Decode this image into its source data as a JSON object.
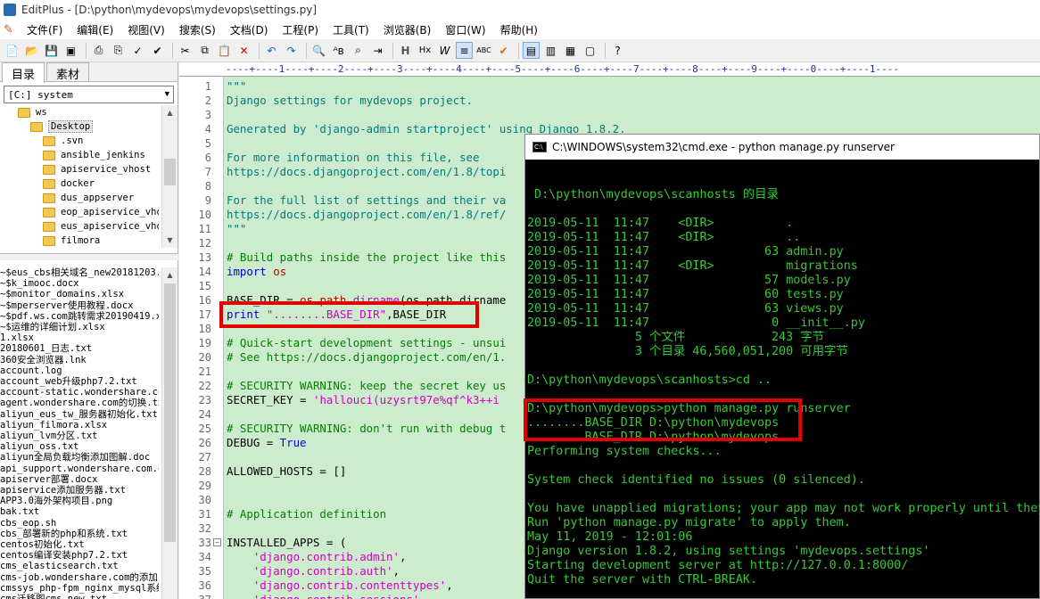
{
  "window": {
    "title": "EditPlus - [D:\\python\\mydevops\\mydevops\\settings.py]"
  },
  "menu": [
    "文件(F)",
    "编辑(E)",
    "视图(V)",
    "搜索(S)",
    "文档(D)",
    "工程(P)",
    "工具(T)",
    "浏览器(B)",
    "窗口(W)",
    "帮助(H)"
  ],
  "toolbar": {
    "buttons": [
      "new-file",
      "open-file",
      "save",
      "save-all",
      "print",
      "print-preview",
      "spell-check",
      "cut",
      "copy",
      "paste",
      "delete",
      "undo",
      "redo",
      "find",
      "replace",
      "find-in-files",
      "goto-line",
      "hex",
      "word-wrap",
      "ruler",
      "abc",
      "check",
      "view1",
      "view2",
      "view3",
      "view4",
      "help"
    ]
  },
  "left_panel": {
    "tabs": [
      "目录",
      "素材"
    ],
    "drive": "[C:] system",
    "tree": [
      {
        "label": "ws",
        "indent": 1
      },
      {
        "label": "Desktop",
        "indent": 2,
        "selected": true
      },
      {
        "label": ".svn",
        "indent": 3
      },
      {
        "label": "ansible_jenkins",
        "indent": 3
      },
      {
        "label": "apiservice_vhost",
        "indent": 3
      },
      {
        "label": "docker",
        "indent": 3
      },
      {
        "label": "dus_appserver",
        "indent": 3
      },
      {
        "label": "eop_apiservice_vhost.",
        "indent": 3
      },
      {
        "label": "eus_apiservice_vhost.",
        "indent": 3
      },
      {
        "label": "filmora",
        "indent": 3
      }
    ],
    "files": [
      "~$eus_cbs相关域名_new20181203.",
      "~$k_imooc.docx",
      "~$monitor_domains.xlsx",
      "~$mperserver使用教程.docx",
      "~$pdf.ws.com跳转需求20190419.x",
      "~$运维的详细计划.xlsx",
      "1.xlsx",
      "20180601_日志.txt",
      "360安全浏览器.lnk",
      "account.log",
      "account_web升级php7.2.txt",
      "account-static.wondershare.com",
      "agent.wondershare.com的切换.tx",
      "aliyun_eus_tw_服务器初始化.txt",
      "aliyun_filmora.xlsx",
      "aliyun_lvm分区.txt",
      "aliyun_oss.txt",
      "aliyun全局负载均衡添加图解.doc",
      "api_support.wondershare.com.ol",
      "apiserver部署.docx",
      "apiservice添加服务器.txt",
      "APP3.0海外架构项目.png",
      "bak.txt",
      "cbs_eop.sh",
      "cbs_部署新的php和系统.txt",
      "centos初始化.txt",
      "centos编译安装php7.2.txt",
      "cms_elasticsearch.txt",
      "cms-job.wondershare.com的添加",
      "cmssys_php-fpm_nginx_mysql系统",
      "cms迁移图cms_new.txt"
    ]
  },
  "editor": {
    "ruler": "----+----1----+----2----+----3----+----4----+----5----+----6----+----7----+----8----+----9----+----0----+----1----",
    "lines": [
      {
        "n": "1",
        "text": "\"\"\"",
        "cls": "c-str"
      },
      {
        "n": "2",
        "text": "Django settings for mydevops project.",
        "cls": "c-str"
      },
      {
        "n": "3",
        "text": "",
        "cls": ""
      },
      {
        "n": "4",
        "text": "Generated by 'django-admin startproject' using Django 1.8.2.",
        "cls": "c-str"
      },
      {
        "n": "5",
        "text": "",
        "cls": ""
      },
      {
        "n": "6",
        "text": "For more information on this file, see",
        "cls": "c-str"
      },
      {
        "n": "7",
        "text": "https://docs.djangoproject.com/en/1.8/topi",
        "cls": "c-str"
      },
      {
        "n": "8",
        "text": "",
        "cls": ""
      },
      {
        "n": "9",
        "text": "For the full list of settings and their va",
        "cls": "c-str"
      },
      {
        "n": "10",
        "text": "https://docs.djangoproject.com/en/1.8/ref/",
        "cls": "c-str"
      },
      {
        "n": "11",
        "text": "\"\"\"",
        "cls": "c-str"
      },
      {
        "n": "12",
        "text": "",
        "cls": ""
      },
      {
        "n": "13",
        "text": "# Build paths inside the project like this",
        "cls": "c-cmt"
      },
      {
        "n": "14",
        "text": "import os",
        "cls": "import"
      },
      {
        "n": "15",
        "text": "",
        "cls": ""
      },
      {
        "n": "16",
        "text": "BASE_DIR = os.path.dirname(os.path.dirname",
        "cls": "base"
      },
      {
        "n": "17",
        "text": "print \"........BASE_DIR\",BASE_DIR",
        "cls": "print"
      },
      {
        "n": "18",
        "text": "",
        "cls": ""
      },
      {
        "n": "19",
        "text": "# Quick-start development settings - unsui",
        "cls": "c-cmt"
      },
      {
        "n": "20",
        "text": "# See https://docs.djangoproject.com/en/1.",
        "cls": "c-cmt"
      },
      {
        "n": "21",
        "text": "",
        "cls": ""
      },
      {
        "n": "22",
        "text": "# SECURITY WARNING: keep the secret key us",
        "cls": "c-cmt"
      },
      {
        "n": "23",
        "text": "SECRET_KEY = 'hallouci(uzysrt97e%qf^k3++i",
        "cls": "secret"
      },
      {
        "n": "24",
        "text": "",
        "cls": ""
      },
      {
        "n": "25",
        "text": "# SECURITY WARNING: don't run with debug t",
        "cls": "c-cmt"
      },
      {
        "n": "26",
        "text": "DEBUG = True",
        "cls": "debug"
      },
      {
        "n": "27",
        "text": "",
        "cls": ""
      },
      {
        "n": "28",
        "text": "ALLOWED_HOSTS = []",
        "cls": ""
      },
      {
        "n": "29",
        "text": "",
        "cls": ""
      },
      {
        "n": "30",
        "text": "",
        "cls": ""
      },
      {
        "n": "31",
        "text": "# Application definition",
        "cls": "c-cmt"
      },
      {
        "n": "32",
        "text": "",
        "cls": ""
      },
      {
        "n": "33",
        "text": "INSTALLED_APPS = (",
        "cls": "",
        "fold": true
      },
      {
        "n": "34",
        "text": "    'django.contrib.admin',",
        "cls": "app"
      },
      {
        "n": "35",
        "text": "    'django.contrib.auth',",
        "cls": "app"
      },
      {
        "n": "36",
        "text": "    'django.contrib.contenttypes',",
        "cls": "app"
      },
      {
        "n": "37",
        "text": "    'django.contrib.sessions',",
        "cls": "app"
      }
    ]
  },
  "cmd": {
    "title": "C:\\WINDOWS\\system32\\cmd.exe - python  manage.py runserver",
    "lines": [
      "",
      "",
      " D:\\python\\mydevops\\scanhosts 的目录",
      "",
      "2019-05-11  11:47    <DIR>          .",
      "2019-05-11  11:47    <DIR>          ..",
      "2019-05-11  11:47                63 admin.py",
      "2019-05-11  11:47    <DIR>          migrations",
      "2019-05-11  11:47                57 models.py",
      "2019-05-11  11:47                60 tests.py",
      "2019-05-11  11:47                63 views.py",
      "2019-05-11  11:47                 0 __init__.py",
      "               5 个文件            243 字节",
      "               3 个目录 46,560,051,200 可用字节",
      "",
      "D:\\python\\mydevops\\scanhosts>cd ..",
      "",
      "D:\\python\\mydevops>python manage.py runserver",
      "........BASE_DIR D:\\python\\mydevops",
      "........BASE_DIR D:\\python\\mydevops",
      "Performing system checks...",
      "",
      "System check identified no issues (0 silenced).",
      "",
      "You have unapplied migrations; your app may not work properly until they",
      "Run 'python manage.py migrate' to apply them.",
      "May 11, 2019 - 12:01:06",
      "Django version 1.8.2, using settings 'mydevops.settings'",
      "Starting development server at http://127.0.0.1:8000/",
      "Quit the server with CTRL-BREAK.",
      "_"
    ]
  },
  "colors": {
    "editor_bg": "#cdeccd",
    "highlight_box": "#e00000",
    "cmd_text": "#37c837"
  }
}
